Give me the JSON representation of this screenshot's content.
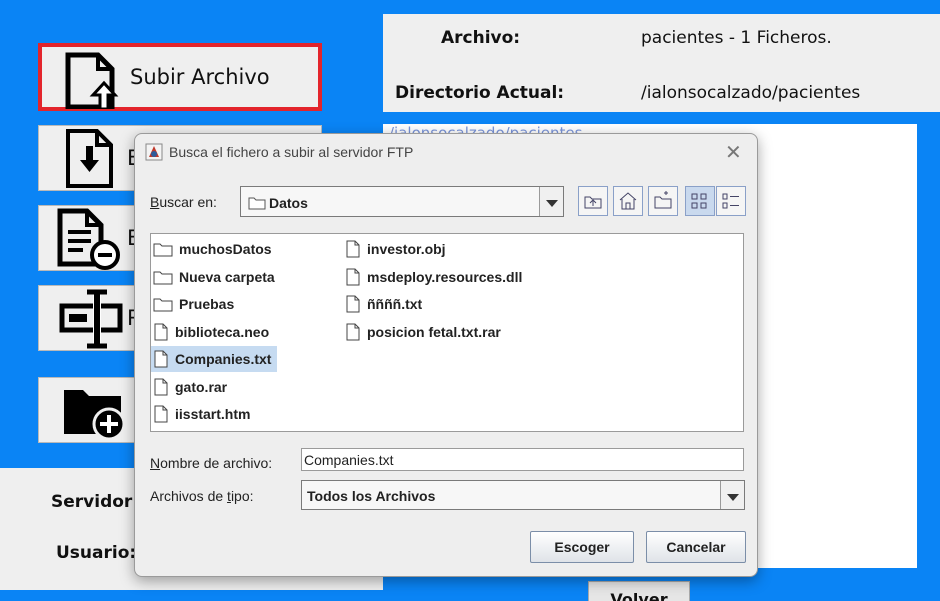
{
  "main": {
    "buttons": [
      {
        "label": "Subir Archivo",
        "icon": "file-upload-icon"
      },
      {
        "label": "B",
        "icon": "file-download-icon"
      },
      {
        "label": "B",
        "icon": "file-remove-icon"
      },
      {
        "label": "R",
        "icon": "rename-icon"
      },
      {
        "label": "",
        "icon": "folder-add-icon"
      }
    ],
    "info": {
      "archivo_label": "Archivo:",
      "archivo_value": "pacientes - 1 Ficheros.",
      "dir_label": "Directorio Actual:",
      "dir_value": "/ialonsocalzado/pacientes"
    },
    "textarea_text": "/ialonsocalzado/pacientes",
    "servidor_label": "Servidor:",
    "usuario_label": "Usuario:",
    "volver_label": "Volver",
    "accent": "#0a84f5",
    "highlight": "#e3242b"
  },
  "dialog": {
    "title": "Busca el fichero a subir al servidor FTP",
    "look_in_prefix": "B",
    "look_in_rest": "uscar en:",
    "look_in_value": "Datos",
    "files": [
      {
        "name": "muchosDatos",
        "type": "folder"
      },
      {
        "name": "Nueva carpeta",
        "type": "folder"
      },
      {
        "name": "Pruebas",
        "type": "folder"
      },
      {
        "name": "biblioteca.neo",
        "type": "file"
      },
      {
        "name": "Companies.txt",
        "type": "file",
        "selected": true
      },
      {
        "name": "gato.rar",
        "type": "file"
      },
      {
        "name": "iisstart.htm",
        "type": "file"
      },
      {
        "name": "investor.obj",
        "type": "file"
      },
      {
        "name": "msdeploy.resources.dll",
        "type": "file"
      },
      {
        "name": "ññññ.txt",
        "type": "file"
      },
      {
        "name": "posicion fetal.txt.rar",
        "type": "file"
      }
    ],
    "filename_prefix": "N",
    "filename_rest": "ombre de archivo:",
    "filename_value": "Companies.txt",
    "filetype_prefix": "Archivos de ",
    "filetype_ul": "t",
    "filetype_rest": "ipo:",
    "filetype_value": "Todos los Archivos",
    "ok_label": "Escoger",
    "cancel_label": "Cancelar",
    "selection_color": "#c6dbf1"
  }
}
